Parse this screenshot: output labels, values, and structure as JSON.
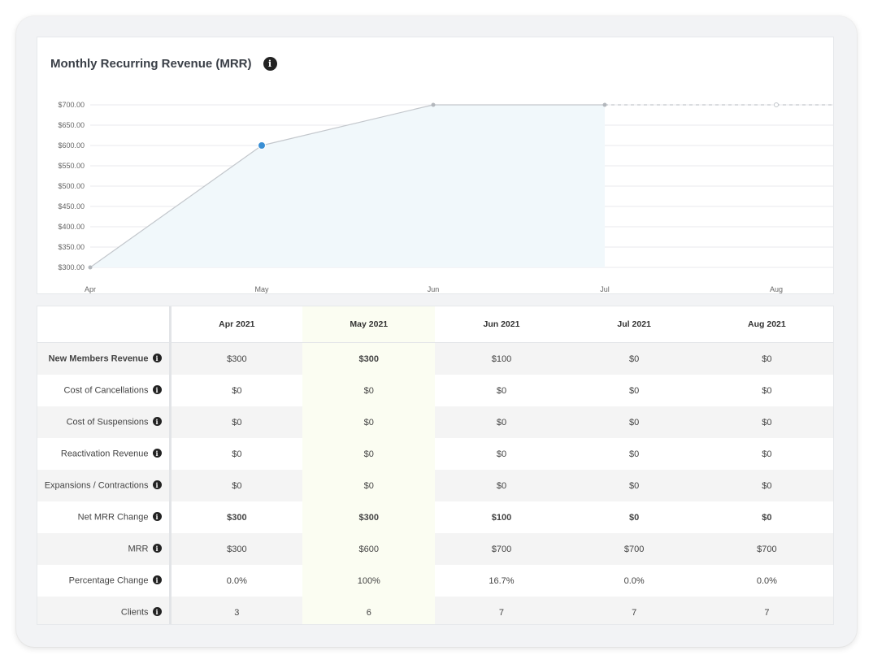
{
  "chart_data": {
    "type": "area",
    "title": "Monthly Recurring Revenue (MRR)",
    "xlabel": "",
    "ylabel": "",
    "categories": [
      "Apr",
      "May",
      "Jun",
      "Jul",
      "Aug"
    ],
    "series": [
      {
        "values": [
          300,
          600,
          700,
          700,
          700
        ]
      }
    ],
    "ylim": [
      300,
      700
    ],
    "yticks": [
      "$300.00",
      "$350.00",
      "$400.00",
      "$450.00",
      "$500.00",
      "$550.00",
      "$600.00",
      "$650.00",
      "$700.00"
    ],
    "ytick_values": [
      300,
      350,
      400,
      450,
      500,
      550,
      600,
      650,
      700
    ],
    "projected_from_index": 3,
    "highlighted_index": 1,
    "grid": true,
    "colors": {
      "line": "#c3c7cc",
      "fill": "#f1f8fb",
      "highlight": "#3a8fd4",
      "grid": "#e8eaed"
    }
  },
  "table": {
    "columns": [
      "Apr 2021",
      "May 2021",
      "Jun 2021",
      "Jul 2021",
      "Aug 2021"
    ],
    "highlighted_column": 1,
    "rows": [
      {
        "label": "New Members Revenue",
        "label_bold": true,
        "values": [
          "$300",
          "$300",
          "$100",
          "$0",
          "$0"
        ],
        "bold_cells": [
          1
        ]
      },
      {
        "label": "Cost of Cancellations",
        "values": [
          "$0",
          "$0",
          "$0",
          "$0",
          "$0"
        ]
      },
      {
        "label": "Cost of Suspensions",
        "values": [
          "$0",
          "$0",
          "$0",
          "$0",
          "$0"
        ]
      },
      {
        "label": "Reactivation Revenue",
        "values": [
          "$0",
          "$0",
          "$0",
          "$0",
          "$0"
        ]
      },
      {
        "label": "Expansions / Contractions",
        "values": [
          "$0",
          "$0",
          "$0",
          "$0",
          "$0"
        ]
      },
      {
        "label": "Net MRR Change",
        "values": [
          "$300",
          "$300",
          "$100",
          "$0",
          "$0"
        ],
        "bold_cells": [
          0,
          1,
          2,
          3,
          4
        ]
      },
      {
        "label": "MRR",
        "values": [
          "$300",
          "$600",
          "$700",
          "$700",
          "$700"
        ]
      },
      {
        "label": "Percentage Change",
        "values": [
          "0.0%",
          "100%",
          "16.7%",
          "0.0%",
          "0.0%"
        ]
      },
      {
        "label": "Clients",
        "values": [
          "3",
          "6",
          "7",
          "7",
          "7"
        ]
      }
    ]
  },
  "icons": {
    "info": "info-icon"
  }
}
